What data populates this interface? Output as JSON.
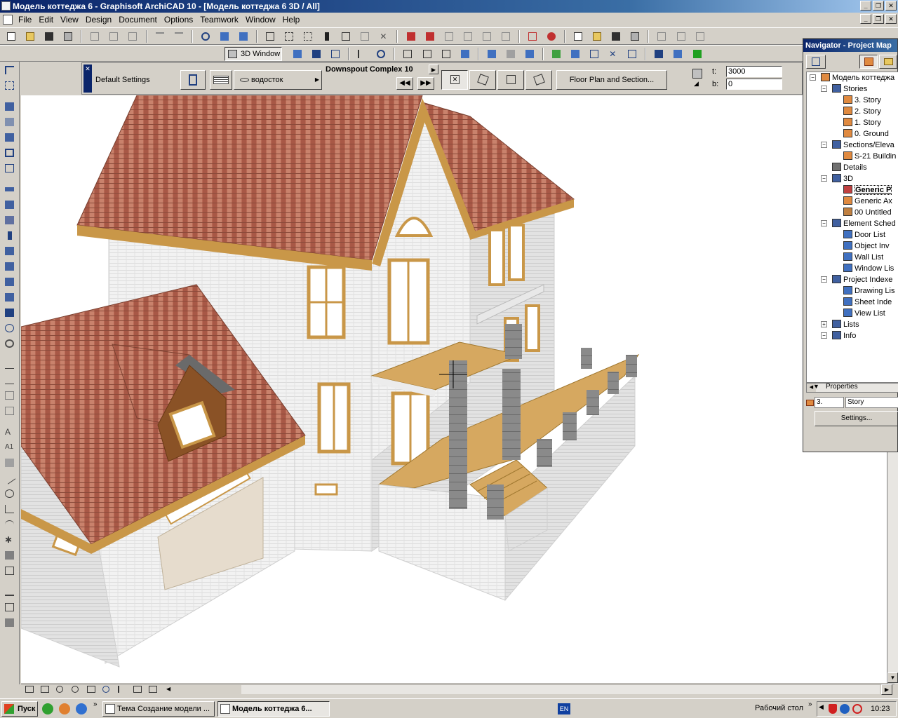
{
  "window": {
    "title": "Модель коттеджа 6 - Graphisoft ArchiCAD 10 - [Модель коттеджа 6 3D / All]",
    "buttons": [
      "_",
      "❐",
      "✕"
    ]
  },
  "menubar": {
    "items": [
      "File",
      "Edit",
      "View",
      "Design",
      "Document",
      "Options",
      "Teamwork",
      "Window",
      "Help"
    ]
  },
  "toolbar2": {
    "view_3d_label": "3D Window"
  },
  "infobox": {
    "default_settings": "Default Settings",
    "profile_name": "водосток",
    "object_name": "Downspout Complex 10",
    "floor_plan_button": "Floor Plan and Section...",
    "t_label": "t:",
    "t_value": "3000",
    "b_label": "b:",
    "b_value": "0"
  },
  "navigator": {
    "title": "Navigator - Project Map",
    "tree": [
      {
        "label": "Модель коттеджа",
        "icon": "house-icon",
        "level": 0,
        "toggle": "−"
      },
      {
        "label": "Stories",
        "icon": "stories-icon",
        "level": 1,
        "toggle": "−"
      },
      {
        "label": "3. Story",
        "icon": "story-icon",
        "level": 2,
        "toggle": ""
      },
      {
        "label": "2. Story",
        "icon": "story-icon",
        "level": 2,
        "toggle": ""
      },
      {
        "label": "1. Story",
        "icon": "story-icon",
        "level": 2,
        "toggle": ""
      },
      {
        "label": "0. Ground",
        "icon": "story-icon",
        "level": 2,
        "toggle": ""
      },
      {
        "label": "Sections/Eleva",
        "icon": "section-icon",
        "level": 1,
        "toggle": "−"
      },
      {
        "label": "S-21 Buildin",
        "icon": "section-house-icon",
        "level": 2,
        "toggle": ""
      },
      {
        "label": "Details",
        "icon": "details-icon",
        "level": 1,
        "toggle": ""
      },
      {
        "label": "3D",
        "icon": "3d-icon",
        "level": 1,
        "toggle": "−"
      },
      {
        "label": "Generic P",
        "icon": "camera-icon",
        "level": 2,
        "toggle": "",
        "selected": true
      },
      {
        "label": "Generic Ax",
        "icon": "axon-icon",
        "level": 2,
        "toggle": ""
      },
      {
        "label": "00 Untitled",
        "icon": "path-icon",
        "level": 2,
        "toggle": ""
      },
      {
        "label": "Element Sched",
        "icon": "schedule-icon",
        "level": 1,
        "toggle": "−"
      },
      {
        "label": "Door List",
        "icon": "list-icon",
        "level": 2,
        "toggle": ""
      },
      {
        "label": "Object Inv",
        "icon": "list-icon",
        "level": 2,
        "toggle": ""
      },
      {
        "label": "Wall List",
        "icon": "list-icon",
        "level": 2,
        "toggle": ""
      },
      {
        "label": "Window Lis",
        "icon": "list-icon",
        "level": 2,
        "toggle": ""
      },
      {
        "label": "Project Indexe",
        "icon": "index-icon",
        "level": 1,
        "toggle": "−"
      },
      {
        "label": "Drawing Lis",
        "icon": "list-icon",
        "level": 2,
        "toggle": ""
      },
      {
        "label": "Sheet Inde",
        "icon": "list-icon",
        "level": 2,
        "toggle": ""
      },
      {
        "label": "View List",
        "icon": "list-icon",
        "level": 2,
        "toggle": ""
      },
      {
        "label": "Lists",
        "icon": "lists-icon",
        "level": 1,
        "toggle": "+"
      },
      {
        "label": "Info",
        "icon": "info-icon",
        "level": 1,
        "toggle": "−"
      }
    ],
    "properties_label": "Properties",
    "prop_number": "3.",
    "prop_name": "Story",
    "settings_button": "Settings..."
  },
  "taskbar": {
    "start_label": "Пуск",
    "tasks": [
      {
        "label": "Тема Создание модели ...",
        "active": false
      },
      {
        "label": "Модель коттеджа 6...",
        "active": true
      }
    ],
    "lang": "EN",
    "desktop_label": "Рабочий стол",
    "clock": "10:23"
  }
}
